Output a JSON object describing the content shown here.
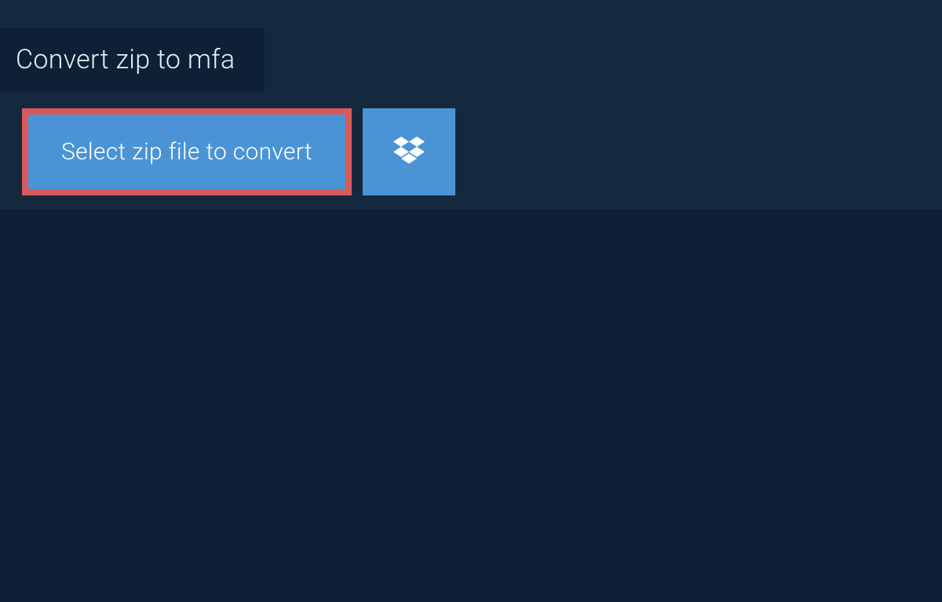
{
  "header": {
    "title": "Convert zip to mfa"
  },
  "actions": {
    "select_label": "Select zip file to convert",
    "dropbox_icon": "dropbox-icon"
  },
  "colors": {
    "bg_light": "#15293e",
    "bg_dark": "#0d2035",
    "button_blue": "#4a94d6",
    "highlight_border": "#d95a5a",
    "text_light": "#ffffff"
  }
}
